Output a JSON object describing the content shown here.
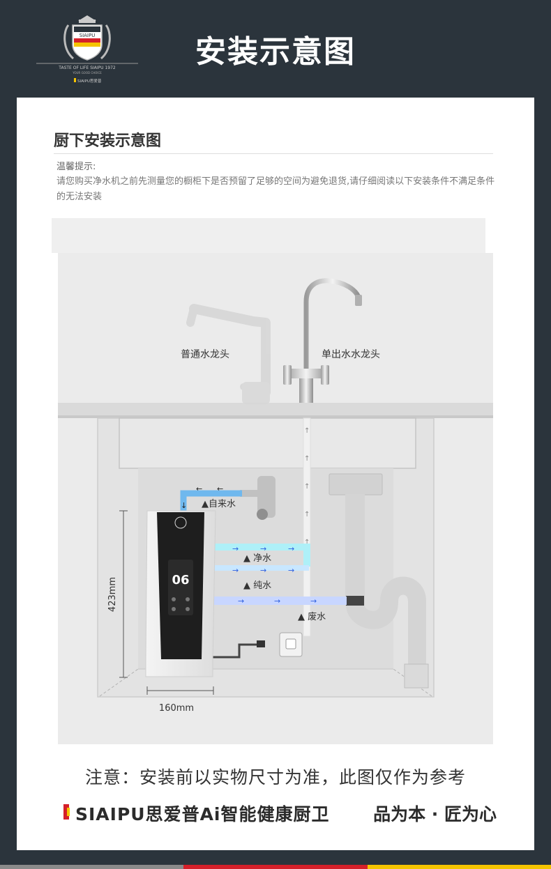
{
  "header": {
    "title": "安装示意图",
    "logo": {
      "emblem_text": "SIAIPU",
      "tagline": "TASTE OF LIFE SIAIPU 1972",
      "subtagline": "YOUR GOOD CHOICE",
      "mini_brand": "SIAIPU思爱普"
    }
  },
  "section": {
    "title": "厨下安装示意图",
    "tip_label": "温馨提示:",
    "tip_text": "请您购买净水机之前先测量您的橱柜下是否预留了足够的空间为避免退货,请仔细阅读以下安装条件不满足条件的无法安装"
  },
  "diagram": {
    "labels": {
      "normal_faucet": "普通水龙头",
      "single_faucet": "单出水水龙头",
      "tap_water": "▲自来水",
      "clean_water": "▲ 净水",
      "pure_water": "▲ 纯水",
      "waste_water": "▲ 废水"
    },
    "dimensions": {
      "height": "423mm",
      "width": "160mm"
    },
    "device_display": "06",
    "colors": {
      "tap_water": "#6fb8ee",
      "clean_water": "#aef0f8",
      "pure_water": "#c8d6ff",
      "waste_water": "#9aaee0",
      "device_front": "#1e1e1e"
    }
  },
  "footer": {
    "note": "注意：安装前以实物尺寸为准，此图仅作为参考",
    "brand": "SIAIPU思爱普Ai智能健康厨卫",
    "slogan": "品为本 · 匠为心"
  },
  "bottom_bar_colors": [
    "#8a8a8a",
    "#d5202a",
    "#f5c400"
  ]
}
